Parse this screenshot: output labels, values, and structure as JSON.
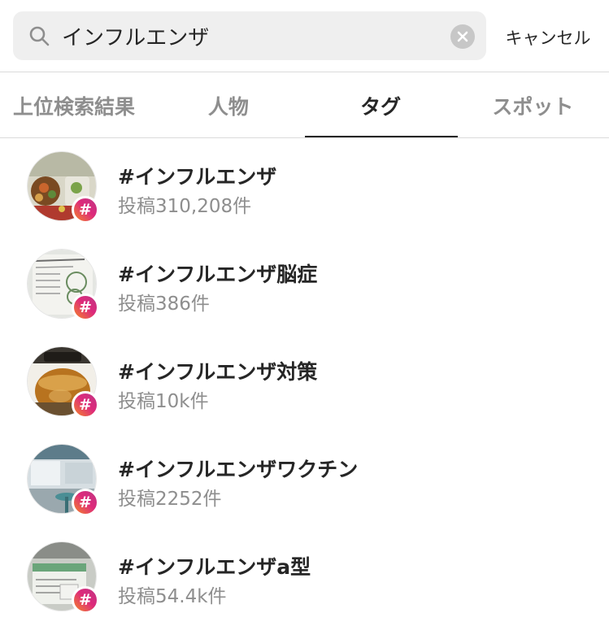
{
  "search": {
    "query": "インフルエンザ",
    "cancel_label": "キャンセル"
  },
  "tabs": [
    {
      "label": "上位検索結果",
      "active": false
    },
    {
      "label": "人物",
      "active": false
    },
    {
      "label": "タグ",
      "active": true
    },
    {
      "label": "スポット",
      "active": false
    }
  ],
  "results": [
    {
      "tag": "#インフルエンザ",
      "count": "投稿310,208件",
      "thumb_icon": "food-photo-thumbnail"
    },
    {
      "tag": "#インフルエンザ脳症",
      "count": "投稿386件",
      "thumb_icon": "document-photo-thumbnail"
    },
    {
      "tag": "#インフルエンザ対策",
      "count": "投稿10k件",
      "thumb_icon": "tea-pot-photo-thumbnail"
    },
    {
      "tag": "#インフルエンザワクチン",
      "count": "投稿2252件",
      "thumb_icon": "clinic-photo-thumbnail"
    },
    {
      "tag": "#インフルエンザa型",
      "count": "投稿54.4k件",
      "thumb_icon": "medicine-bag-photo-thumbnail"
    }
  ],
  "hash_badge_symbol": "#",
  "colors": {
    "search_bg": "#efefef",
    "active_tab": "#262626",
    "inactive_tab": "#8e8e8e",
    "badge_gradient_start": "#f58529",
    "badge_gradient_end": "#c13584"
  }
}
